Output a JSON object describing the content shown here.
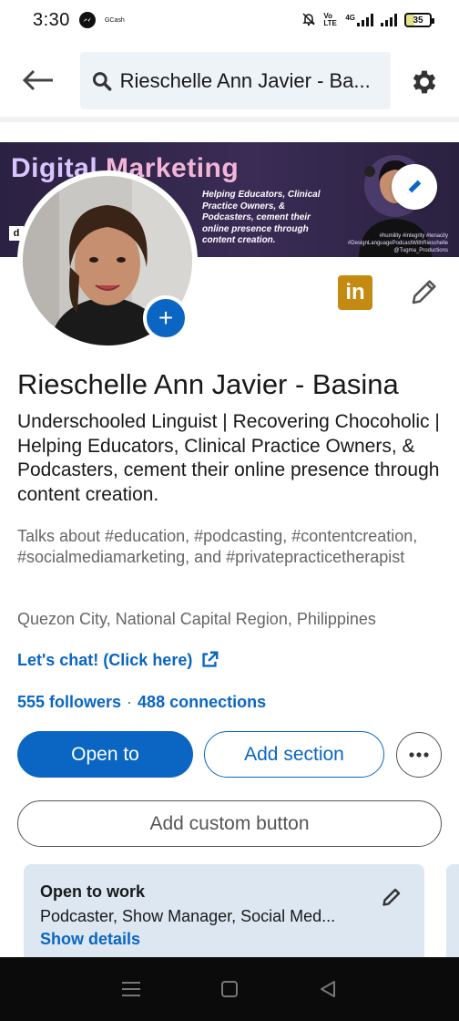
{
  "status_bar": {
    "time": "3:30",
    "app_label": "GCash",
    "network_label": "4G",
    "volte_label": "Vo LTE",
    "battery_level": "35"
  },
  "top_bar": {
    "search_value": "Rieschelle Ann Javier - Ba..."
  },
  "banner": {
    "title_part1": "Digital ",
    "title_part2": "Marketing",
    "tagline": "Helping Educators, Clinical Practice Owners, & Podcasters, cement their online presence through content creation.",
    "hashtags_line1": "#humility #integrity #tenacity",
    "hashtags_line2": "#DesignLanguagePodcastWithRieschelle",
    "hashtags_line3": "@Tugma_Productions"
  },
  "profile": {
    "name": "Rieschelle Ann Javier - Basina",
    "headline": "Underschooled Linguist | Recovering Chocoholic | Helping Educators, Clinical Practice Owners, & Podcasters, cement their online presence through content creation.",
    "talks_about": "Talks about #education, #podcasting, #contentcreation, #socialmediamarketing, and #privatepracticetherapist",
    "location": "Quezon City, National Capital Region, Philippines",
    "website_label": "Let's chat! (Click here)",
    "followers": "555 followers",
    "separator": "·",
    "connections": "488 connections"
  },
  "actions": {
    "open_to": "Open to",
    "add_section": "Add section",
    "add_custom_button": "Add custom button"
  },
  "open_to_work": {
    "title": "Open to work",
    "roles": "Podcaster, Show Manager, Social Med...",
    "show_details": "Show details"
  },
  "colors": {
    "primary": "#0a66c2",
    "card_bg": "#dde7f1",
    "linkedin_badge": "#c58a12"
  }
}
